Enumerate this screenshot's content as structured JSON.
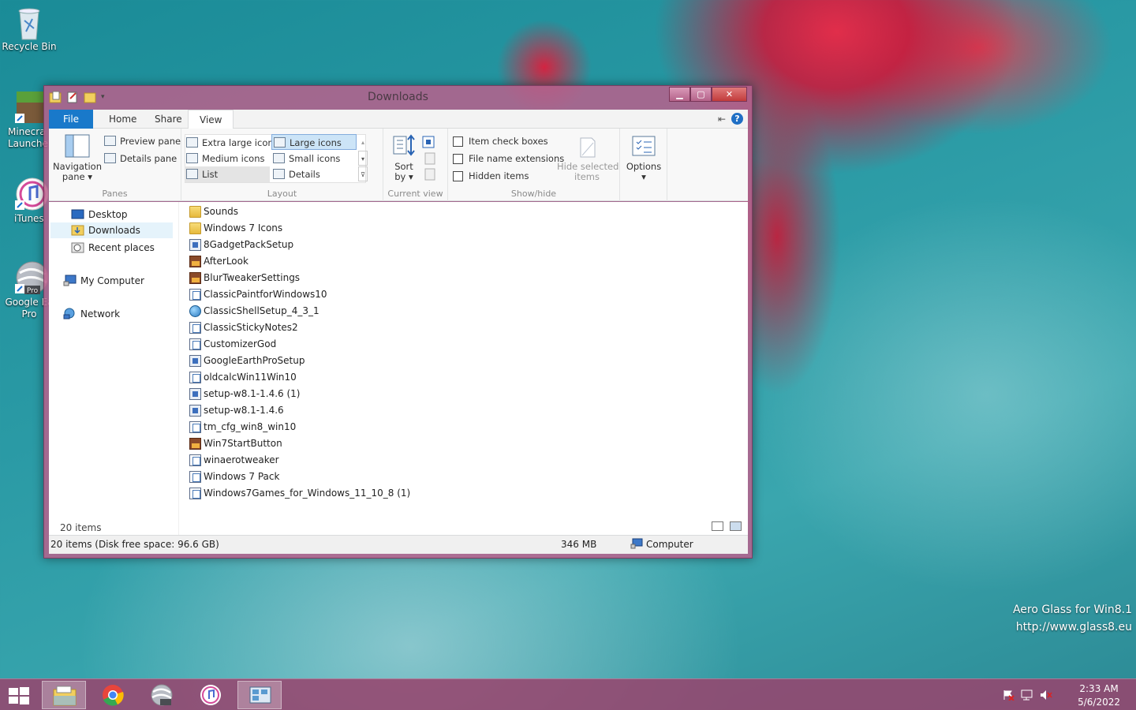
{
  "desktop": {
    "icons": [
      {
        "label": "Recycle Bin"
      },
      {
        "label": "Minecra\nLaunche"
      },
      {
        "label": "iTunes"
      },
      {
        "label": "Google Ea\nPro",
        "badge": "Pro"
      }
    ],
    "watermark": {
      "line1": "Aero Glass for Win8.1",
      "line2": "http://www.glass8.eu"
    }
  },
  "window": {
    "title": "Downloads",
    "tabs": {
      "file": "File",
      "home": "Home",
      "share": "Share",
      "view": "View"
    },
    "ribbon": {
      "panes": {
        "navigation_pane": "Navigation\npane ▾",
        "preview_pane": "Preview pane",
        "details_pane": "Details pane",
        "label": "Panes"
      },
      "layout": {
        "extra_large_icons": "Extra large icons",
        "large_icons": "Large icons",
        "medium_icons": "Medium icons",
        "small_icons": "Small icons",
        "list": "List",
        "details": "Details",
        "label": "Layout"
      },
      "current_view": {
        "sort_by": "Sort\nby ▾",
        "label": "Current view"
      },
      "show_hide": {
        "item_check_boxes": "Item check boxes",
        "file_name_extensions": "File name extensions",
        "hidden_items": "Hidden items",
        "hide_selected_items": "Hide selected\nitems",
        "label": "Show/hide"
      },
      "options": {
        "label": "Options\n▾"
      }
    },
    "nav": {
      "desktop": "Desktop",
      "downloads": "Downloads",
      "recent_places": "Recent places",
      "my_computer": "My Computer",
      "network": "Network"
    },
    "files": [
      {
        "name": "Sounds",
        "icon": "folder"
      },
      {
        "name": "Windows 7 Icons",
        "icon": "folder"
      },
      {
        "name": "8GadgetPackSetup",
        "icon": "setup"
      },
      {
        "name": "AfterLook",
        "icon": "pic"
      },
      {
        "name": "BlurTweakerSettings",
        "icon": "pic"
      },
      {
        "name": "ClassicPaintforWindows10",
        "icon": "app"
      },
      {
        "name": "ClassicShellSetup_4_3_1",
        "icon": "globe"
      },
      {
        "name": "ClassicStickyNotes2",
        "icon": "app"
      },
      {
        "name": "CustomizerGod",
        "icon": "app"
      },
      {
        "name": "GoogleEarthProSetup",
        "icon": "setup"
      },
      {
        "name": "oldcalcWin11Win10",
        "icon": "app"
      },
      {
        "name": "setup-w8.1-1.4.6 (1)",
        "icon": "setup"
      },
      {
        "name": "setup-w8.1-1.4.6",
        "icon": "setup"
      },
      {
        "name": "tm_cfg_win8_win10",
        "icon": "app"
      },
      {
        "name": "Win7StartButton",
        "icon": "pic"
      },
      {
        "name": "winaerotweaker",
        "icon": "app"
      },
      {
        "name": "Windows 7 Pack",
        "icon": "app"
      },
      {
        "name": "Windows7Games_for_Windows_11_10_8 (1)",
        "icon": "app"
      }
    ],
    "items_count": "20 items",
    "status": {
      "summary": "20 items (Disk free space: 96.6 GB)",
      "size": "346 MB",
      "location": "Computer"
    }
  },
  "taskbar": {
    "clock_time": "2:33 AM",
    "clock_date": "5/6/2022"
  }
}
